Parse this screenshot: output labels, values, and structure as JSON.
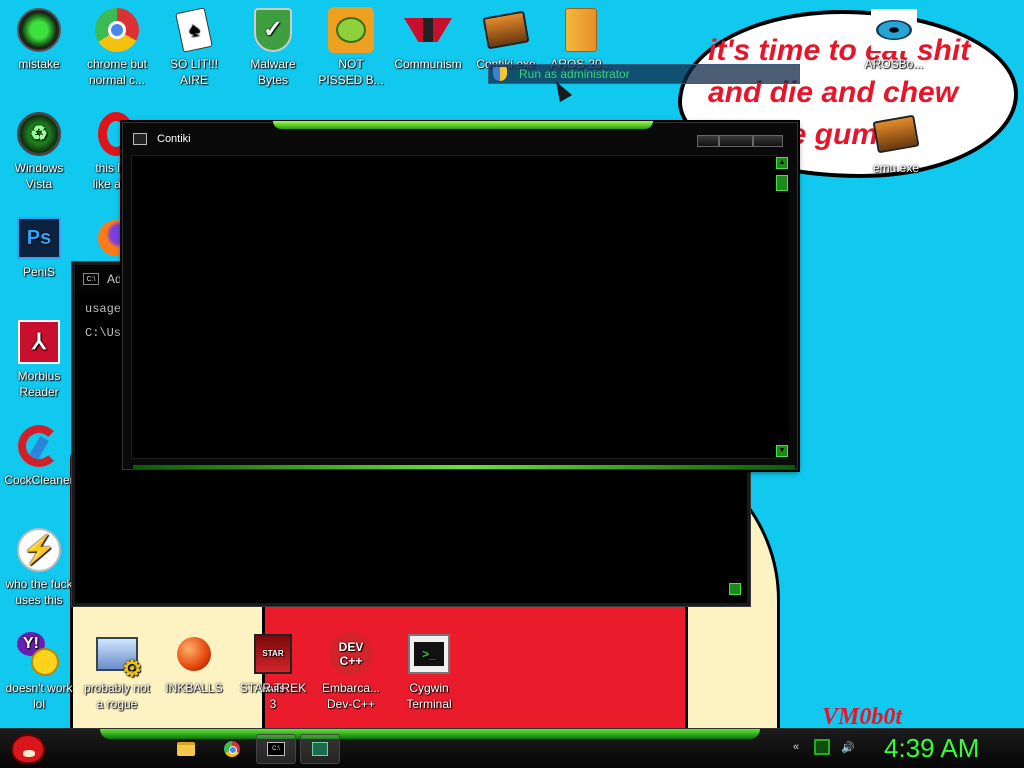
{
  "desktop": {
    "wallpaper_text": "it's time to eat shit\nand die and chew\nbubble gum",
    "signature": "VM0b0t",
    "icons": [
      {
        "label": "mistake",
        "icon": "green-orb-icon"
      },
      {
        "label": "chrome but\nnormal c...",
        "icon": "chrome-icon"
      },
      {
        "label": "SO LIT!!!\nAIRE",
        "icon": "solitaire-icon"
      },
      {
        "label": "Malware\nBytes",
        "icon": "shield-check-icon"
      },
      {
        "label": "NOT\nPISSED B...",
        "icon": "angry-pig-icon"
      },
      {
        "label": "Communism",
        "icon": "eagle-emblem-icon"
      },
      {
        "label": "Contiki.exe",
        "icon": "terminal-app-icon"
      },
      {
        "label": "AROS-20...",
        "icon": "archive-icon"
      },
      {
        "label": "AROSBo...",
        "icon": "cat-eye-icon"
      },
      {
        "label": "Windows\nVista",
        "icon": "recycle-bin-icon"
      },
      {
        "label": "this lo...\nlike a v...",
        "icon": "opera-icon"
      },
      {
        "label": "emu.exe",
        "icon": "terminal-app-icon"
      },
      {
        "label": "PeniS",
        "icon": "photoshop-icon"
      },
      {
        "label": "Morbius\nReader",
        "icon": "pdf-reader-icon"
      },
      {
        "label": "CockCleaner",
        "icon": "ccleaner-icon"
      },
      {
        "label": "who the fuck\nuses this",
        "icon": "winamp-icon"
      },
      {
        "label": "doesn't work\nlol",
        "icon": "yahoo-messenger-icon"
      },
      {
        "label": "probably not\na rogue",
        "icon": "gear-computer-icon"
      },
      {
        "label": "INKBALLS",
        "icon": "inkball-icon"
      },
      {
        "label": "STAR TREK\n3",
        "icon": "star-wars-icon"
      },
      {
        "label": "Embarca...\nDev-C++",
        "icon": "dev-cpp-icon"
      },
      {
        "label": "Cygwin\nTerminal",
        "icon": "cygwin-icon"
      }
    ]
  },
  "context": {
    "run_as_admin": "Run as administrator"
  },
  "cmd_window": {
    "title": "Ad",
    "lines": [
      "usage",
      "",
      "C:\\Us"
    ]
  },
  "main_window": {
    "title": "Contiki"
  },
  "taskbar": {
    "buttons": [
      "folder-icon",
      "chrome-icon",
      "cmd-icon",
      "app-icon"
    ],
    "clock": "4:39 AM"
  },
  "colors": {
    "desktop_bg": "#11c9ef",
    "accent_green": "#34ff34",
    "wallpaper_red": "#e8142a"
  }
}
